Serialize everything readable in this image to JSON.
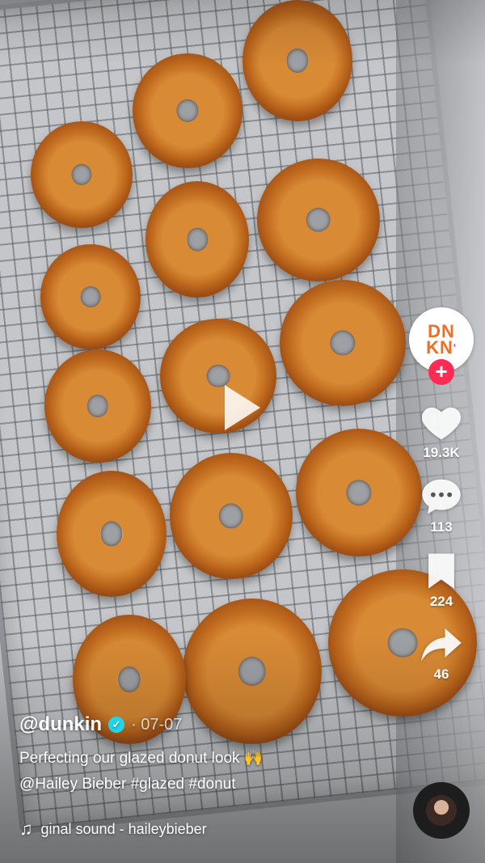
{
  "video": {
    "play_label": "Play"
  },
  "creator": {
    "logo_line1": "DN",
    "logo_line2": "KN",
    "logo_mark": "'",
    "follow_symbol": "+"
  },
  "actions": {
    "likes": "19.3K",
    "comments": "113",
    "saves": "224",
    "shares": "46"
  },
  "post": {
    "username": "@dunkin",
    "verified_symbol": "✓",
    "date": "· 07-07",
    "caption_line1": "Perfecting our glazed donut look 🙌",
    "caption_line2": "@Hailey Bieber #glazed #donut",
    "sound": "ginal sound - haileybieber"
  },
  "colors": {
    "accent": "#fe2c55",
    "brand_orange": "#f36c21",
    "brand_pink": "#d4197b",
    "verified": "#20d5ec"
  }
}
